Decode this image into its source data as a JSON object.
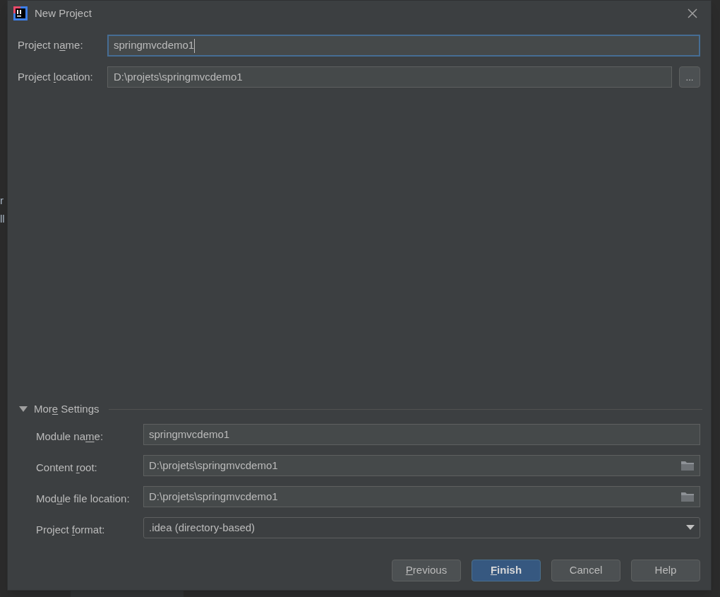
{
  "background_editor": {
    "left_fragments": [
      "r",
      "ll"
    ]
  },
  "window": {
    "title": "New Project"
  },
  "project_name": {
    "label": [
      "Project n",
      "a",
      "me:"
    ],
    "value": "springmvcdemo1",
    "focused": true
  },
  "project_location": {
    "label": [
      "Project ",
      "l",
      "ocation:"
    ],
    "value": "D:\\projets\\springmvcdemo1",
    "browse_button": "..."
  },
  "more_settings": {
    "label": [
      "Mor",
      "e",
      " Settings"
    ],
    "expanded": true,
    "fields": [
      {
        "kind": "text",
        "label": [
          "Module na",
          "m",
          "e:"
        ],
        "value": "springmvcdemo1"
      },
      {
        "kind": "folder",
        "label": [
          "Content ",
          "r",
          "oot:"
        ],
        "value": "D:\\projets\\springmvcdemo1"
      },
      {
        "kind": "folder",
        "label": [
          "Mod",
          "u",
          "le file location:"
        ],
        "value": "D:\\projets\\springmvcdemo1"
      },
      {
        "kind": "dropdown",
        "label": [
          "Project ",
          "f",
          "ormat:"
        ],
        "value": ".idea (directory-based)"
      }
    ]
  },
  "buttons": [
    {
      "mnemonic": "P",
      "label": "revious",
      "default": false
    },
    {
      "mnemonic": "F",
      "label": "inish",
      "default": true
    },
    {
      "label": "Cancel",
      "default": false
    },
    {
      "label": "Help",
      "default": false
    }
  ]
}
